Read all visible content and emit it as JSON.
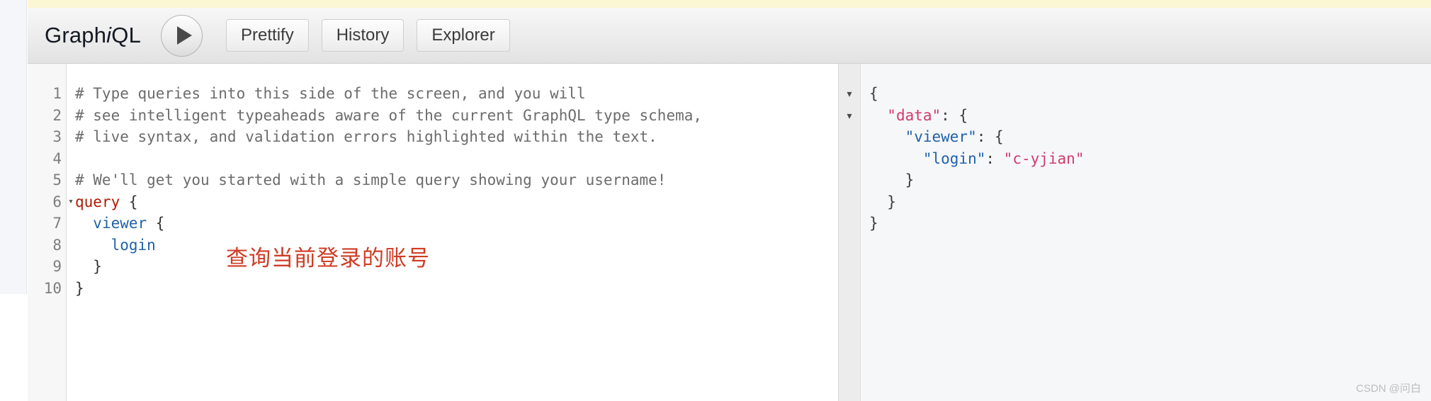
{
  "app": {
    "logo_prefix": "Graph",
    "logo_italic": "i",
    "logo_suffix": "QL"
  },
  "toolbar": {
    "execute_label": "",
    "buttons": [
      {
        "label": "Prettify"
      },
      {
        "label": "History"
      },
      {
        "label": "Explorer"
      }
    ]
  },
  "editor": {
    "line_numbers": [
      "1",
      "2",
      "3",
      "4",
      "5",
      "6",
      "7",
      "8",
      "9",
      "10"
    ],
    "fold_marker": "▾",
    "lines": [
      {
        "n": 1,
        "segments": [
          {
            "text": "# Type queries into this side of the screen, and you will",
            "cls": "tok-comment"
          }
        ]
      },
      {
        "n": 2,
        "segments": [
          {
            "text": "# see intelligent typeaheads aware of the current GraphQL type schema,",
            "cls": "tok-comment"
          }
        ]
      },
      {
        "n": 3,
        "segments": [
          {
            "text": "# live syntax, and validation errors highlighted within the text.",
            "cls": "tok-comment"
          }
        ]
      },
      {
        "n": 4,
        "segments": [
          {
            "text": "",
            "cls": "tok-comment"
          }
        ]
      },
      {
        "n": 5,
        "segments": [
          {
            "text": "# We'll get you started with a simple query showing your username!",
            "cls": "tok-comment"
          }
        ]
      },
      {
        "n": 6,
        "segments": [
          {
            "text": "query",
            "cls": "tok-keyword"
          },
          {
            "text": " {",
            "cls": "tok-punct"
          }
        ]
      },
      {
        "n": 7,
        "segments": [
          {
            "text": "  ",
            "cls": "tok-punct"
          },
          {
            "text": "viewer",
            "cls": "tok-field"
          },
          {
            "text": " {",
            "cls": "tok-punct"
          }
        ]
      },
      {
        "n": 8,
        "segments": [
          {
            "text": "    ",
            "cls": "tok-punct"
          },
          {
            "text": "login",
            "cls": "tok-field"
          }
        ]
      },
      {
        "n": 9,
        "segments": [
          {
            "text": "  }",
            "cls": "tok-punct"
          }
        ]
      },
      {
        "n": 10,
        "segments": [
          {
            "text": "}",
            "cls": "tok-punct"
          }
        ]
      }
    ],
    "annotation": "查询当前登录的账号"
  },
  "result": {
    "fold_markers": [
      "▾",
      "▾",
      "",
      "",
      "",
      "",
      ""
    ],
    "lines": [
      {
        "segments": [
          {
            "text": "{",
            "cls": "rtok-punct"
          }
        ]
      },
      {
        "segments": [
          {
            "text": "  ",
            "cls": "rtok-punct"
          },
          {
            "text": "\"data\"",
            "cls": "rtok-key-a"
          },
          {
            "text": ": {",
            "cls": "rtok-punct"
          }
        ]
      },
      {
        "segments": [
          {
            "text": "    ",
            "cls": "rtok-punct"
          },
          {
            "text": "\"viewer\"",
            "cls": "rtok-key-b"
          },
          {
            "text": ": {",
            "cls": "rtok-punct"
          }
        ]
      },
      {
        "segments": [
          {
            "text": "      ",
            "cls": "rtok-punct"
          },
          {
            "text": "\"login\"",
            "cls": "rtok-key-b"
          },
          {
            "text": ": ",
            "cls": "rtok-punct"
          },
          {
            "text": "\"c-yjian\"",
            "cls": "rtok-str"
          }
        ]
      },
      {
        "segments": [
          {
            "text": "    }",
            "cls": "rtok-punct"
          }
        ]
      },
      {
        "segments": [
          {
            "text": "  }",
            "cls": "rtok-punct"
          }
        ]
      },
      {
        "segments": [
          {
            "text": "}",
            "cls": "rtok-punct"
          }
        ]
      }
    ]
  },
  "watermark": "CSDN @问白",
  "colors": {
    "keyword": "#b11a04",
    "field": "#1f61a9",
    "comment": "#6c6c6c",
    "json_key_data": "#d23b6a",
    "json_key": "#1f61a9",
    "json_string": "#d23b6a",
    "annotation": "#cf3b24",
    "top_strip": "#fbf6d3"
  }
}
